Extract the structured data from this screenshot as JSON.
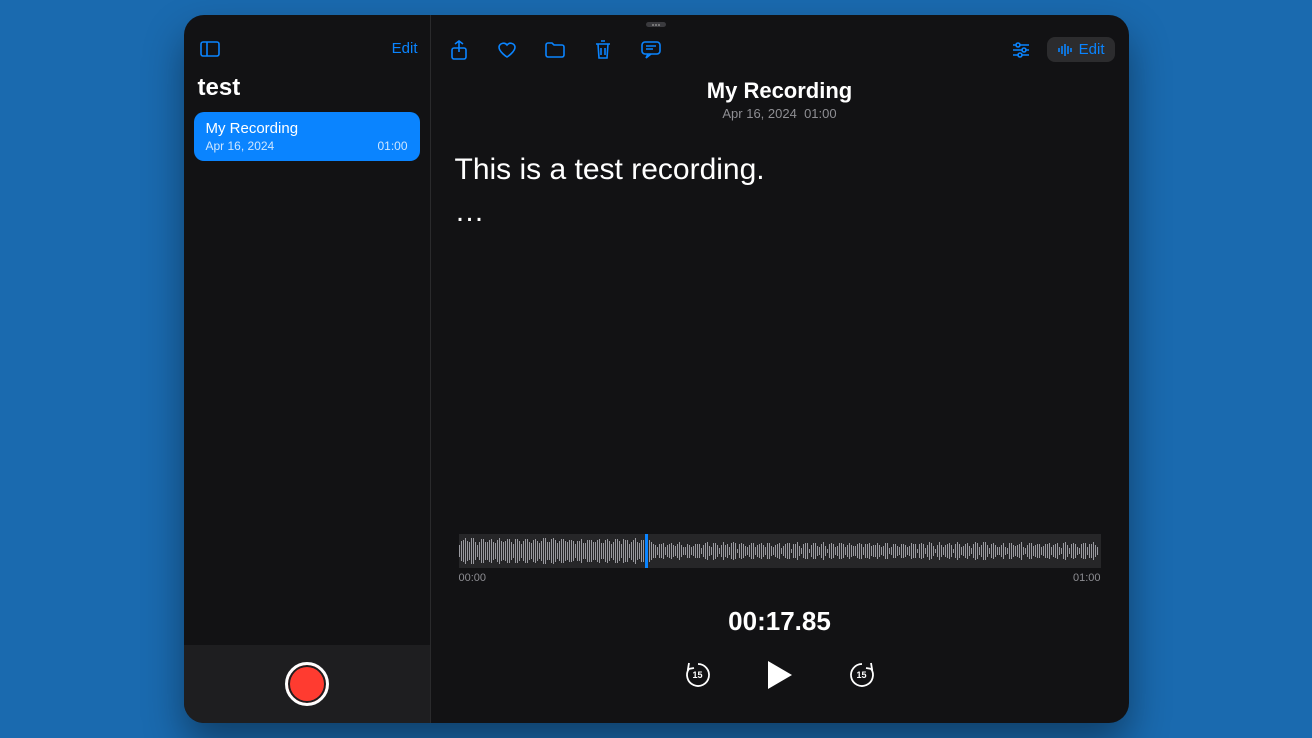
{
  "sidebar": {
    "edit_label": "Edit",
    "folder_title": "test",
    "items": [
      {
        "title": "My Recording",
        "date": "Apr 16, 2024",
        "duration": "01:00"
      }
    ]
  },
  "main": {
    "edit_label": "Edit",
    "title": "My Recording",
    "subtitle_date": "Apr 16, 2024",
    "subtitle_time": "01:00",
    "transcript": "This is a test recording.",
    "transcript_continuation": "…",
    "waveform": {
      "start_label": "00:00",
      "end_label": "01:00",
      "playhead_percent": 29
    },
    "timecode": "00:17.85",
    "skip_seconds": "15"
  },
  "colors": {
    "accent": "#0a84ff",
    "record": "#ff3b30"
  }
}
